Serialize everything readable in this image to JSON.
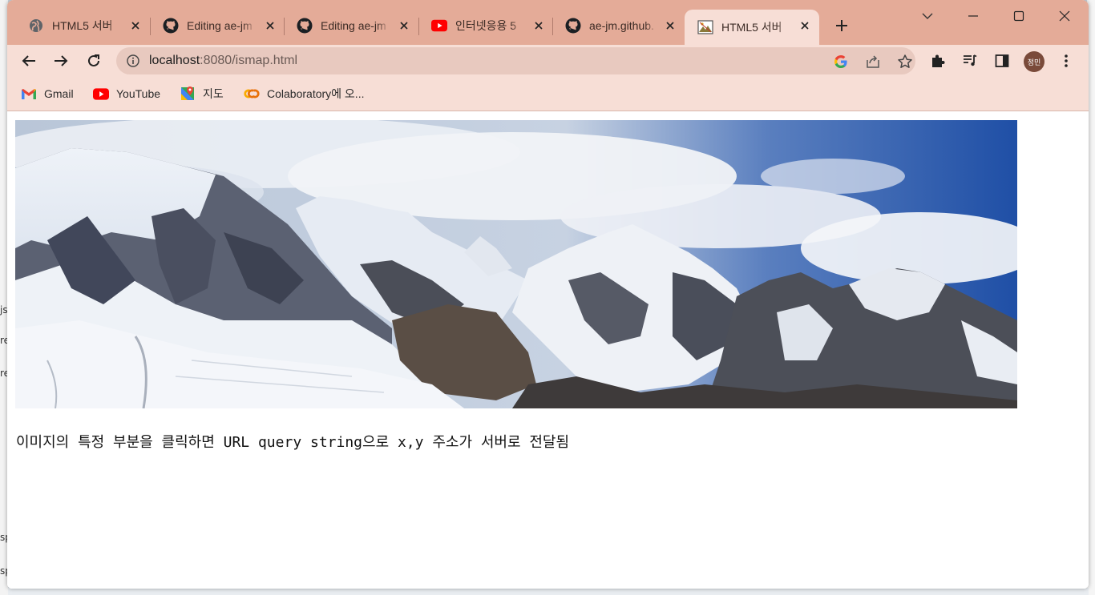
{
  "browser": {
    "tabs": [
      {
        "title": "HTML5 서버",
        "favicon": "globe-icon",
        "active": false
      },
      {
        "title": "Editing ae-jm",
        "favicon": "github-icon",
        "active": false
      },
      {
        "title": "Editing ae-jm",
        "favicon": "github-icon",
        "active": false
      },
      {
        "title": "인터넷응용 5",
        "favicon": "youtube-icon",
        "active": false
      },
      {
        "title": "ae-jm.github.",
        "favicon": "github-icon",
        "active": false
      },
      {
        "title": "HTML5 서버",
        "favicon": "image-icon",
        "active": true
      }
    ],
    "address": {
      "host": "localhost",
      "rest": ":8080/ismap.html"
    },
    "profile": "정민",
    "bookmarks": [
      {
        "label": "Gmail",
        "icon": "gmail-icon"
      },
      {
        "label": "YouTube",
        "icon": "youtube-icon"
      },
      {
        "label": "지도",
        "icon": "maps-icon"
      },
      {
        "label": "Colaboratory에 오...",
        "icon": "colab-icon"
      }
    ],
    "colors": {
      "tabstrip": "#e4ab98",
      "toolbar": "#f7ded6",
      "omnibox": "#e8c9bf"
    }
  },
  "page": {
    "image_alt": "snowy mountain panorama",
    "caption": "이미지의 특정 부분을 클릭하면 URL query string으로 x,y 주소가 서버로 전달됨"
  },
  "background_fragments": [
    "js",
    "re",
    "re",
    "sp",
    "sp"
  ]
}
